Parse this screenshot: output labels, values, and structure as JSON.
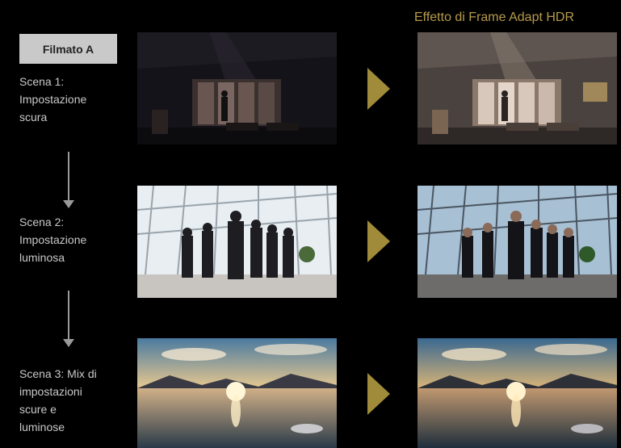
{
  "header": {
    "effect_title": "Effetto di Frame Adapt HDR"
  },
  "footage_tag": "Filmato A",
  "scenes": [
    {
      "label": "Scena 1:\nImpostazione\nscura",
      "original_image": "dark-room-violinist-photo",
      "processed_image": "dark-room-violinist-hdr-photo"
    },
    {
      "label": "Scena 2:\nImpostazione\nluminosa",
      "original_image": "bright-office-business-group-photo",
      "processed_image": "bright-office-business-group-hdr-photo"
    },
    {
      "label": "Scena 3: Mix di\nimpostazioni\nscure e\nluminose",
      "original_image": "sunset-lake-reflection-photo",
      "processed_image": "sunset-lake-reflection-hdr-photo"
    }
  ],
  "colors": {
    "background": "#000000",
    "accent_gold": "#b69a4a",
    "tag_background": "#c9c9c9",
    "arrow_gray": "#9a9a9a"
  }
}
